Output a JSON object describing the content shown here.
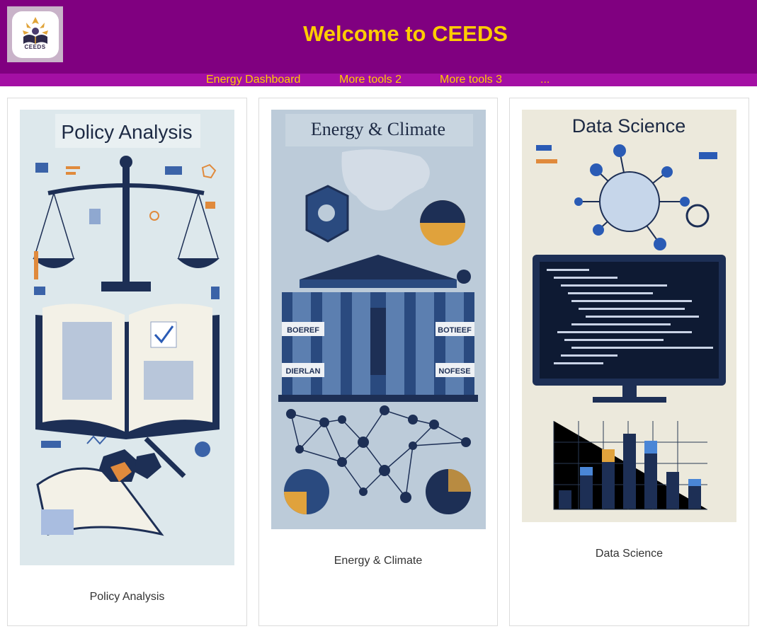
{
  "header": {
    "logo_label": "CEEDS",
    "title": "Welcome to CEEDS",
    "background": "#800080",
    "title_color": "#ffcc00"
  },
  "nav": {
    "background": "#a40fa4",
    "items": [
      {
        "label": "Energy Dashboard"
      },
      {
        "label": "More tools 2"
      },
      {
        "label": "More tools 3"
      },
      {
        "label": "..."
      }
    ]
  },
  "cards": [
    {
      "image_heading": "Policy Analysis",
      "image_labels": [],
      "caption": "Policy Analysis",
      "icon": "scales-and-book-illustration"
    },
    {
      "image_heading": "Energy & Climate",
      "image_labels": [
        "BOEREF",
        "BOTIEEF",
        "DIERLAN",
        "NOFESE"
      ],
      "caption": "Energy & Climate",
      "icon": "building-and-network-illustration"
    },
    {
      "image_heading": "Data Science",
      "image_labels": [],
      "caption": "Data Science",
      "icon": "monitor-and-bar-chart-illustration"
    }
  ]
}
